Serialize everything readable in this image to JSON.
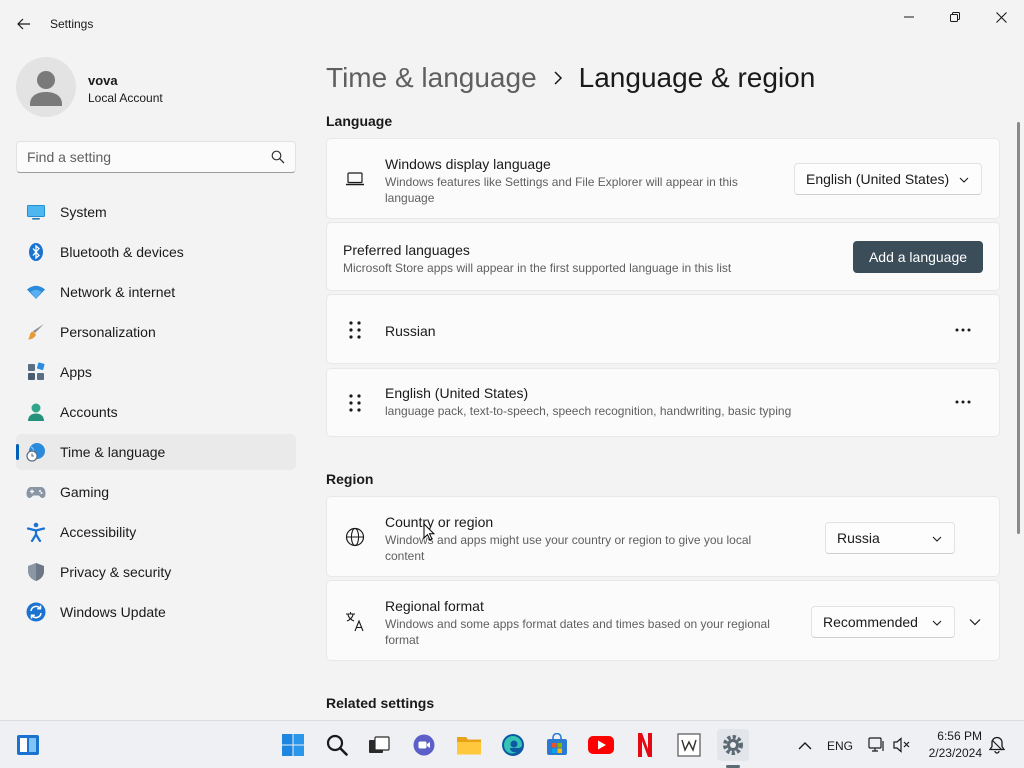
{
  "window": {
    "title": "Settings"
  },
  "profile": {
    "name": "vova",
    "account_type": "Local Account"
  },
  "search": {
    "placeholder": "Find a setting"
  },
  "sidebar": {
    "items": [
      {
        "label": "System",
        "icon": "monitor-icon",
        "active": false
      },
      {
        "label": "Bluetooth & devices",
        "icon": "bluetooth-icon",
        "active": false
      },
      {
        "label": "Network & internet",
        "icon": "wifi-icon",
        "active": false
      },
      {
        "label": "Personalization",
        "icon": "paintbrush-icon",
        "active": false
      },
      {
        "label": "Apps",
        "icon": "apps-icon",
        "active": false
      },
      {
        "label": "Accounts",
        "icon": "person-icon",
        "active": false
      },
      {
        "label": "Time & language",
        "icon": "globe-clock-icon",
        "active": true
      },
      {
        "label": "Gaming",
        "icon": "gamepad-icon",
        "active": false
      },
      {
        "label": "Accessibility",
        "icon": "accessibility-icon",
        "active": false
      },
      {
        "label": "Privacy & security",
        "icon": "shield-icon",
        "active": false
      },
      {
        "label": "Windows Update",
        "icon": "update-icon",
        "active": false
      }
    ]
  },
  "breadcrumb": {
    "parent": "Time & language",
    "current": "Language & region"
  },
  "language_section": {
    "title": "Language",
    "display_language": {
      "title": "Windows display language",
      "description": "Windows features like Settings and File Explorer will appear in this language",
      "value": "English (United States)"
    },
    "preferred": {
      "title": "Preferred languages",
      "description": "Microsoft Store apps will appear in the first supported language in this list",
      "button": "Add a language"
    },
    "languages": [
      {
        "name": "Russian",
        "detail": ""
      },
      {
        "name": "English (United States)",
        "detail": "language pack, text-to-speech, speech recognition, handwriting, basic typing"
      }
    ]
  },
  "region_section": {
    "title": "Region",
    "country": {
      "title": "Country or region",
      "description": "Windows and apps might use your country or region to give you local content",
      "value": "Russia"
    },
    "format": {
      "title": "Regional format",
      "description": "Windows and some apps format dates and times based on your regional format",
      "value": "Recommended"
    }
  },
  "related": {
    "title": "Related settings"
  },
  "taskbar": {
    "apps": [
      "start-icon",
      "search-icon",
      "task-view-icon",
      "chat-icon",
      "file-explorer-icon",
      "edge-icon",
      "store-icon",
      "youtube-icon",
      "netflix-icon",
      "wikipedia-icon",
      "settings-icon"
    ],
    "language": "ENG",
    "time": "6:56 PM",
    "date": "2/23/2024"
  },
  "colors": {
    "accent": "#005fb8",
    "primary_button": "#3c4d5a",
    "background": "#f3f3f3",
    "card": "#fbfbfb"
  }
}
